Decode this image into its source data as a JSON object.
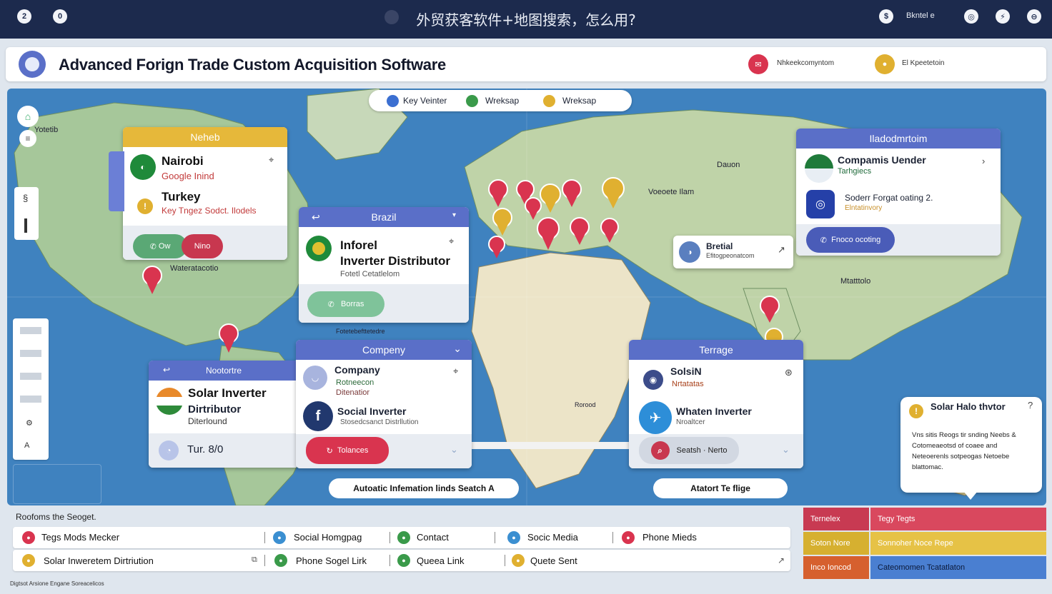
{
  "topbar": {
    "title": "外贸获客软件+地图搜索，怎么用?",
    "left_icons": [
      "2",
      "0"
    ],
    "right_icons": [
      "$",
      "◎",
      "⚡",
      "⊖"
    ],
    "user_label": "Bkntel e"
  },
  "header": {
    "app_title": "Advanced Forign Trade Custom Acquisition Software",
    "chips": [
      {
        "label": "Nhkeekcomyntom",
        "color": "#d9344f",
        "icon": "mail-icon"
      },
      {
        "label": "El Kpeetetoin",
        "color": "#e0b030",
        "icon": "user-icon"
      }
    ]
  },
  "map": {
    "legend": [
      {
        "label": "Key Veinter",
        "color": "#3b6fd1"
      },
      {
        "label": "Wreksap",
        "color": "#3a9a4a"
      },
      {
        "label": "Wreksap",
        "color": "#e0b030"
      }
    ],
    "labels": {
      "top_left": "Yotetib",
      "mid_left": "Wateratacotio",
      "europe": "Dauon",
      "asia_north": "Voeoete Ilam",
      "asia": "Mtatttolo",
      "africa": "Rorood",
      "under_brazil": "Fotetebefttetedre"
    },
    "search_buttons": [
      "Autoatic Infemation linds Seatch A",
      "Atatort Te flige"
    ]
  },
  "cards": {
    "nairobi": {
      "header": "Neheb",
      "title": "Nairobi",
      "subtitle": "Google Inind",
      "title2": "Turkey",
      "subtitle2": "Key Tngez Sodct. Ilodels",
      "btn1": "Ow",
      "btn2": "Nino"
    },
    "brazil": {
      "header": "Brazil",
      "title_line1": "Inforel",
      "title_line2": "Inverter Distributor",
      "subtitle": "Fotetl Cetatlelom",
      "button": "Borras"
    },
    "company": {
      "header": "Compeny",
      "title": "Company",
      "subtitle_a": "Rotneecon",
      "subtitle_b": "Ditenatior",
      "title2": "Social Inverter",
      "subtitle2": "Stosedcsanct Distrllution",
      "button": "Tolances"
    },
    "solar": {
      "header": "Nootortre",
      "title_line1": "Solar Inverter",
      "title_line2": "Dirtributor",
      "subtitle": "Diterlound",
      "footer": "Tur. 8/0"
    },
    "terrace": {
      "header": "Terrage",
      "title": "SolsiN",
      "subtitle": "Nrtatatas",
      "title2": "Whaten Inverter",
      "subtitle2": "Nroaltcer",
      "button": "Seatsh · Nerto"
    },
    "right": {
      "header": "Iladodmrtoim",
      "title": "Compamis Uender",
      "subtitle": "Tarhgiecs",
      "title2": "Soderr Forgat oating 2.",
      "subtitle2": "Elntatinvory",
      "button": "Fnoco ocoting"
    },
    "small": {
      "title": "Bretial",
      "subtitle": "Efitogpeonatcom"
    },
    "tooltip": {
      "title": "Solar Halo thvtor",
      "text": "Vns sitis Reogs tir snding Neebs & Cotomeaeotsd of coaee and Neteoerenls sotpeogas Netoebe blattomac."
    }
  },
  "table": {
    "heading": "Roofoms the Seoget.",
    "rows": [
      [
        {
          "label": "Tegs Mods Mecker",
          "color": "#d9344f"
        },
        {
          "label": "Social Homgpag",
          "color": "#3b8fd1"
        },
        {
          "label": "Contact",
          "color": "#3a9a4a"
        },
        {
          "label": "Socic Media",
          "color": "#3b8fd1"
        },
        {
          "label": "Phone Mieds",
          "color": "#d9344f"
        }
      ],
      [
        {
          "label": "Solar Inweretem Dirtriution",
          "color": "#e0b030"
        },
        {
          "label": "Phone Sogel Lirk",
          "color": "#3a9a4a"
        },
        {
          "label": "Queea Link",
          "color": "#3a9a4a"
        },
        {
          "label": "Quete Sent",
          "color": "#e0b030"
        }
      ]
    ],
    "legend_grid": [
      {
        "a": "Ternelex",
        "b": "Tegy Tegts",
        "color_a": "#c83a52",
        "color_b": "#d9485e"
      },
      {
        "a": "Soton Nore",
        "b": "Sonnoher Noce Repe",
        "color_a": "#d6b030",
        "color_b": "#e6c246"
      },
      {
        "a": "Inco Ioncod",
        "b": "Cateomomen Tcatatlaton",
        "color_a": "#d6602e",
        "color_b": "#4a7fd1"
      }
    ]
  },
  "footer": "Digtsot Arsione Engane Soreacelicos",
  "colors": {
    "navy": "#1c2a4d",
    "accent": "#5a6fc8",
    "ocean": "#3f82bf",
    "land": "#a6c79a"
  }
}
